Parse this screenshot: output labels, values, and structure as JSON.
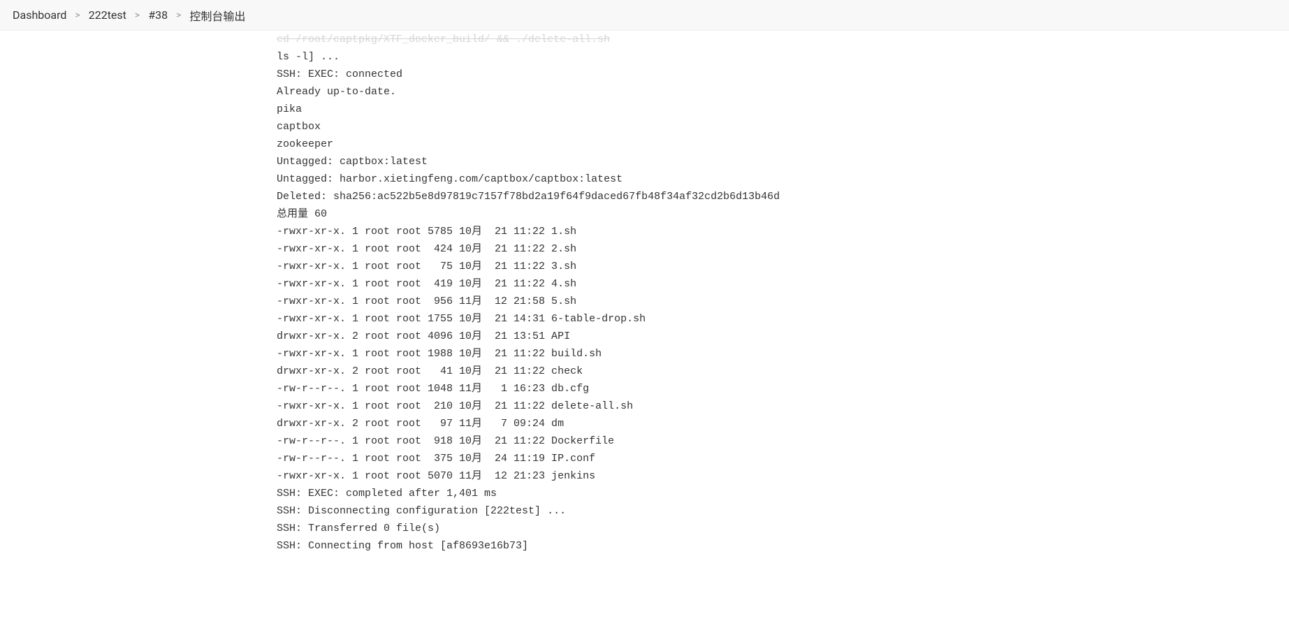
{
  "breadcrumb": {
    "items": [
      {
        "label": "Dashboard"
      },
      {
        "label": "222test"
      },
      {
        "label": "#38"
      },
      {
        "label": "控制台输出"
      }
    ],
    "separator": ">"
  },
  "console": {
    "lines": [
      "cd /root/captpkg/XTF_docker_build/ && ./delete-all.sh",
      "ls -l] ...",
      "SSH: EXEC: connected",
      "Already up-to-date.",
      "pika",
      "captbox",
      "zookeeper",
      "Untagged: captbox:latest",
      "Untagged: harbor.xietingfeng.com/captbox/captbox:latest",
      "Deleted: sha256:ac522b5e8d97819c7157f78bd2a19f64f9daced67fb48f34af32cd2b6d13b46d",
      "总用量 60",
      "-rwxr-xr-x. 1 root root 5785 10月  21 11:22 1.sh",
      "-rwxr-xr-x. 1 root root  424 10月  21 11:22 2.sh",
      "-rwxr-xr-x. 1 root root   75 10月  21 11:22 3.sh",
      "-rwxr-xr-x. 1 root root  419 10月  21 11:22 4.sh",
      "-rwxr-xr-x. 1 root root  956 11月  12 21:58 5.sh",
      "-rwxr-xr-x. 1 root root 1755 10月  21 14:31 6-table-drop.sh",
      "drwxr-xr-x. 2 root root 4096 10月  21 13:51 API",
      "-rwxr-xr-x. 1 root root 1988 10月  21 11:22 build.sh",
      "drwxr-xr-x. 2 root root   41 10月  21 11:22 check",
      "-rw-r--r--. 1 root root 1048 11月   1 16:23 db.cfg",
      "-rwxr-xr-x. 1 root root  210 10月  21 11:22 delete-all.sh",
      "drwxr-xr-x. 2 root root   97 11月   7 09:24 dm",
      "-rw-r--r--. 1 root root  918 10月  21 11:22 Dockerfile",
      "-rw-r--r--. 1 root root  375 10月  24 11:19 IP.conf",
      "-rwxr-xr-x. 1 root root 5070 11月  12 21:23 jenkins",
      "SSH: EXEC: completed after 1,401 ms",
      "SSH: Disconnecting configuration [222test] ...",
      "SSH: Transferred 0 file(s)",
      "SSH: Connecting from host [af8693e16b73]"
    ]
  }
}
